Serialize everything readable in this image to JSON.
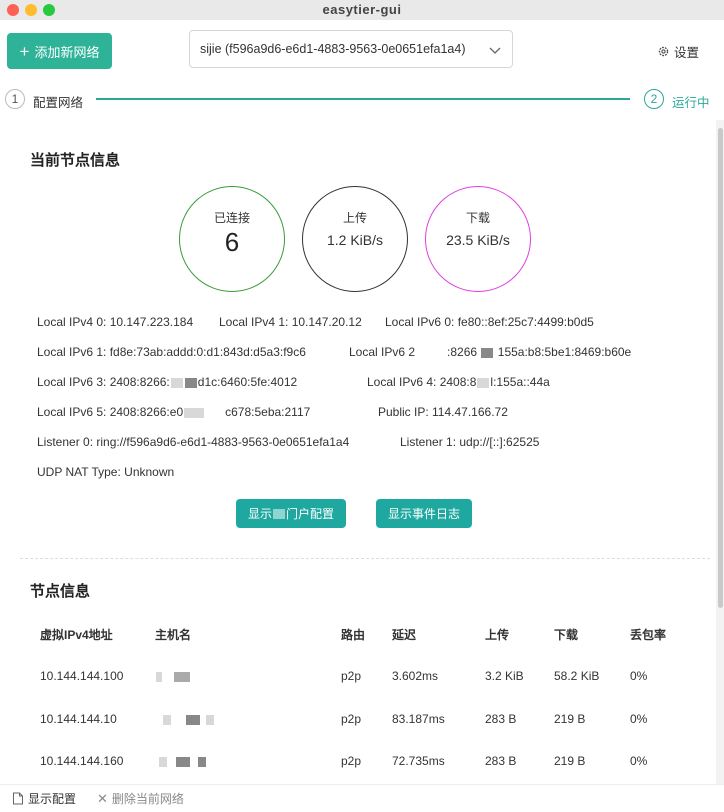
{
  "window": {
    "title": "easytier-gui"
  },
  "topbar": {
    "add_label": "添加新网络",
    "network_select": "sijie (f596a9d6-e6d1-4883-9563-0e0651efa1a4)",
    "settings_label": "设置"
  },
  "steps": [
    {
      "number": "1",
      "label": "配置网络"
    },
    {
      "number": "2",
      "label": "运行中"
    }
  ],
  "node_info": {
    "title": "当前节点信息",
    "stats": [
      {
        "label": "已连接",
        "value": "6",
        "color": "#3a9b3a"
      },
      {
        "label": "上传",
        "value": "1.2 KiB/s",
        "color": "#333333"
      },
      {
        "label": "下载",
        "value": "23.5 KiB/s",
        "color": "#e040e0"
      }
    ],
    "local_ipv4_0": "Local IPv4 0: 10.147.223.184",
    "local_ipv4_1": "Local IPv4 1: 10.147.20.12",
    "local_ipv6_0": "Local IPv6 0: fe80::8ef:25c7:4499:b0d5",
    "local_ipv6_1": "Local IPv6 1: fd8e:73ab:addd:0:d1:843d:d5a3:f9c6",
    "local_ipv6_2a": "Local IPv6 2",
    "local_ipv6_2b": ":8266",
    "local_ipv6_2c": "155a:b8:5be1:8469:b60e",
    "local_ipv6_3a": "Local IPv6 3: 2408:8266:",
    "local_ipv6_3b": "d1c:6460:5fe:4012",
    "local_ipv6_4a": "Local IPv6 4: 2408:8",
    "local_ipv6_4b": "l:155a::44a",
    "local_ipv6_5a": "Local IPv6 5: 2408:8266:e0",
    "local_ipv6_5b": "c678:5eba:2117",
    "public_ip": "Public IP: 114.47.166.72",
    "listener_0": "Listener 0: ring://f596a9d6-e6d1-4883-9563-0e0651efa1a4",
    "listener_1": "Listener 1: udp://[::]:62525",
    "nat_type": "UDP NAT Type: Unknown",
    "btn_portal_a": "显示",
    "btn_portal_b": "门户配置",
    "btn_events": "显示事件日志"
  },
  "peers": {
    "title": "节点信息",
    "columns": [
      "虚拟IPv4地址",
      "主机名",
      "路由",
      "延迟",
      "上传",
      "下载",
      "丢包率"
    ],
    "rows": [
      {
        "ip": "10.144.144.100",
        "route": "p2p",
        "latency": "3.602ms",
        "up": "3.2 KiB",
        "down": "58.2 KiB",
        "loss": "0%"
      },
      {
        "ip": "10.144.144.10",
        "route": "p2p",
        "latency": "83.187ms",
        "up": "283 B",
        "down": "219 B",
        "loss": "0%"
      },
      {
        "ip": "10.144.144.160",
        "route": "p2p",
        "latency": "72.735ms",
        "up": "283 B",
        "down": "219 B",
        "loss": "0%"
      }
    ]
  },
  "bottombar": {
    "show_config": "显示配置",
    "delete_network": "删除当前网络"
  },
  "colors": {
    "accent": "#2eb399",
    "button": "#1fa8a0",
    "step": "#2ba89a"
  },
  "icons": [
    "plus-icon",
    "chevron-down-icon",
    "gear-icon",
    "doc-icon",
    "close-icon"
  ]
}
